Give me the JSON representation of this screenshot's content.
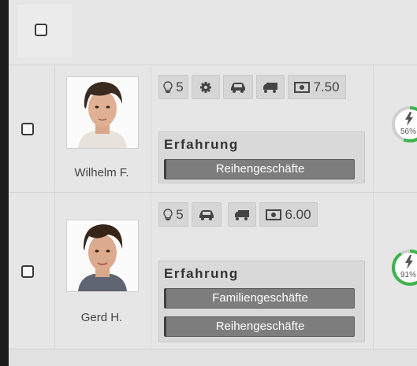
{
  "rows": [
    {
      "name": "Wilhelm F.",
      "chips": {
        "bulb_value": "5",
        "money_value": "7.50"
      },
      "experience": {
        "title": "Erfahrung",
        "tags": [
          "Reihengeschäfte"
        ]
      },
      "gauge": {
        "label": "56%",
        "percent": 56,
        "color": "#3cb44b"
      }
    },
    {
      "name": "Gerd H.",
      "chips": {
        "bulb_value": "5",
        "money_value": "6.00"
      },
      "experience": {
        "title": "Erfahrung",
        "tags": [
          "Familiengeschäfte",
          "Reihengeschäfte"
        ]
      },
      "gauge": {
        "label": "91%",
        "percent": 91,
        "color": "#3cb44b"
      }
    }
  ],
  "icons": [
    "bulb-icon",
    "gear-icon",
    "car-icon",
    "truck-icon",
    "money-icon",
    "lightning-icon"
  ]
}
